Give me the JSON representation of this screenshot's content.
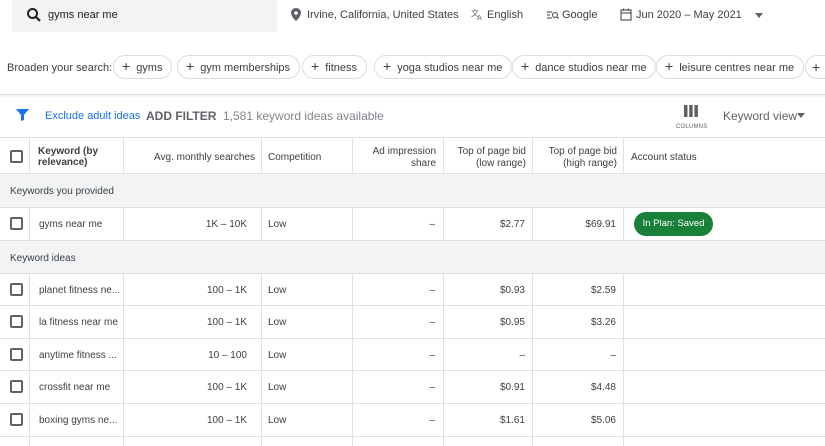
{
  "topbar": {
    "query": "gyms near me",
    "location": "Irvine, California, United States",
    "language": "English",
    "network": "Google",
    "date_range": "Jun 2020 – May 2021"
  },
  "broaden": {
    "label": "Broaden your search:",
    "chips": [
      "gyms",
      "gym memberships",
      "fitness",
      "yoga studios near me",
      "dance studios near me",
      "leisure centres near me"
    ]
  },
  "toolbar": {
    "exclude_label": "Exclude adult ideas",
    "add_filter": "ADD FILTER",
    "ideas_count": "1,581 keyword ideas available",
    "columns_label": "COLUMNS",
    "view_label": "Keyword view"
  },
  "table": {
    "headers": {
      "keyword": [
        "Keyword (by",
        "relevance)"
      ],
      "searches": "Avg. monthly searches",
      "competition": "Competition",
      "impression": [
        "Ad impression",
        "share"
      ],
      "bid_low": [
        "Top of page bid",
        "(low range)"
      ],
      "bid_high": [
        "Top of page bid",
        "(high range)"
      ],
      "status": "Account status"
    },
    "provided_label": "Keywords you provided",
    "provided": [
      {
        "keyword": "gyms near me",
        "searches": "1K – 10K",
        "competition": "Low",
        "impression": "–",
        "bid_low": "$2.77",
        "bid_high": "$69.91",
        "status": "In Plan: Saved"
      }
    ],
    "ideas_label": "Keyword ideas",
    "ideas": [
      {
        "keyword": "planet fitness ne...",
        "searches": "100 – 1K",
        "competition": "Low",
        "impression": "–",
        "bid_low": "$0.93",
        "bid_high": "$2.59"
      },
      {
        "keyword": "la fitness near me",
        "searches": "100 – 1K",
        "competition": "Low",
        "impression": "–",
        "bid_low": "$0.95",
        "bid_high": "$3.26"
      },
      {
        "keyword": "anytime fitness ...",
        "searches": "10 – 100",
        "competition": "Low",
        "impression": "–",
        "bid_low": "–",
        "bid_high": "–"
      },
      {
        "keyword": "crossfit near me",
        "searches": "100 – 1K",
        "competition": "Low",
        "impression": "–",
        "bid_low": "$0.91",
        "bid_high": "$4.48"
      },
      {
        "keyword": "boxing gyms ne...",
        "searches": "100 – 1K",
        "competition": "Low",
        "impression": "–",
        "bid_low": "$1.61",
        "bid_high": "$5.06"
      }
    ]
  },
  "colors": {
    "accent": "#1a73e8",
    "saved_badge": "#188038",
    "section_bg": "#f1f3f4"
  }
}
